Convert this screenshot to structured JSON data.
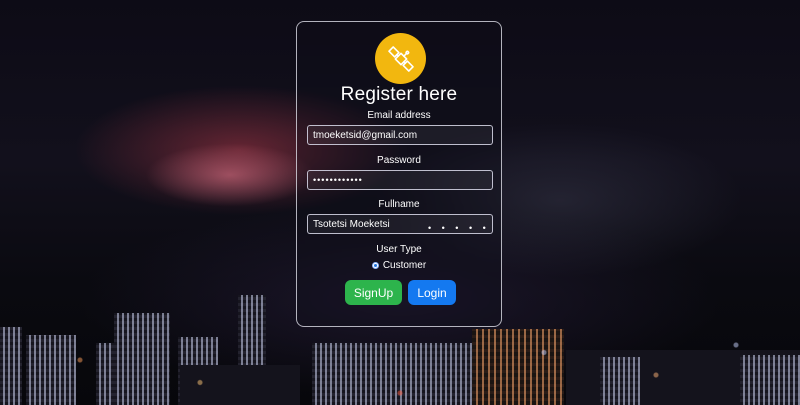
{
  "form": {
    "title": "Register here",
    "email": {
      "label": "Email address",
      "value": "tmoeketsid@gmail.com"
    },
    "password": {
      "label": "Password",
      "value": "••••••••••••"
    },
    "fullname": {
      "label": "Fullname",
      "value": "Tsotetsi Moeketsi",
      "overlay_dots": "• • • • •"
    },
    "user_type": {
      "label": "User Type",
      "option": "Customer"
    },
    "signup_label": "SignUp",
    "login_label": "Login"
  },
  "colors": {
    "logo_bg": "#f2b70f",
    "signup": "#2db44c",
    "login": "#1479f0"
  },
  "icons": {
    "logo": "satellite-icon"
  }
}
